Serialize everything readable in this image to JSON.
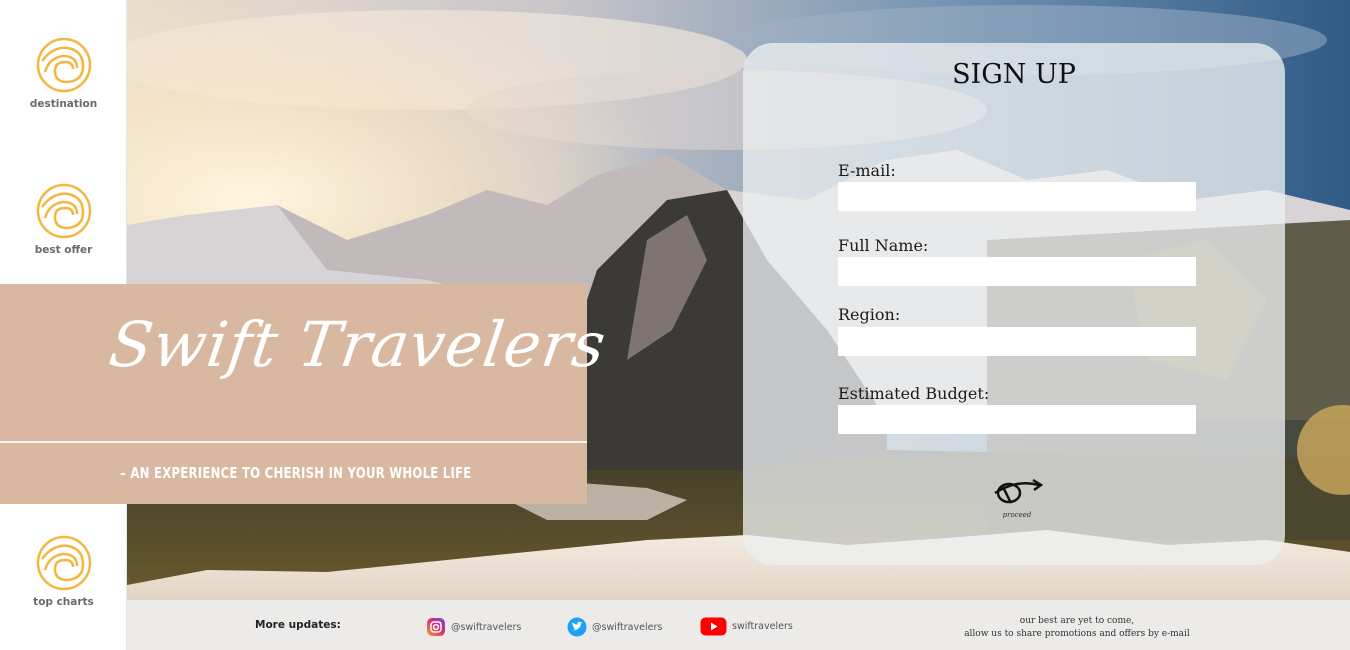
{
  "sidebar": {
    "items": [
      {
        "label": "destination"
      },
      {
        "label": "best offer"
      },
      {
        "label": "top charts"
      }
    ]
  },
  "brand": {
    "title": "Swift Travelers",
    "tagline": "– AN EXPERIENCE TO CHERISH IN YOUR WHOLE LIFE"
  },
  "signup": {
    "title": "SIGN UP",
    "fields": [
      {
        "label": "E-mail:",
        "value": ""
      },
      {
        "label": "Full Name:",
        "value": ""
      },
      {
        "label": "Region:",
        "value": ""
      },
      {
        "label": "Estimated Budget:",
        "value": ""
      }
    ],
    "proceed_label": "proceed"
  },
  "footer": {
    "more_updates": "More updates:",
    "social": [
      {
        "network": "instagram-icon",
        "handle": "@swiftravelers"
      },
      {
        "network": "twitter-icon",
        "handle": "@swiftravelers"
      },
      {
        "network": "youtube-icon",
        "handle": "swiftravelers"
      }
    ],
    "note_line1": "our best are yet to come,",
    "note_line2": "allow us to share promotions and offers by e-mail"
  },
  "colors": {
    "accent": "#d9b8a1",
    "logo": "#f2b642",
    "card": "#eceef0",
    "youtube": "#ff0000",
    "twitter": "#1da1f2"
  }
}
